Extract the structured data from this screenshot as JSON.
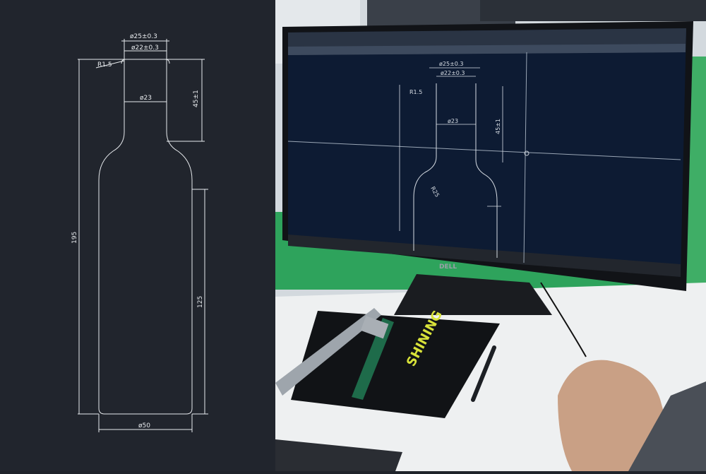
{
  "drawing": {
    "dim_outer_neck": "ø25±0.3",
    "dim_inner_neck": "ø22±0.3",
    "dim_radius": "R1.5",
    "dim_neck_width": "ø23",
    "dim_neck_height": "45±1",
    "dim_total_height": "195",
    "dim_body_height": "125",
    "dim_body_diameter": "ø50"
  },
  "photo": {
    "monitor_brand": "DELL",
    "notebook_brand": "SHINING",
    "screen_dims": {
      "outer": "ø25±0.3",
      "inner": "ø22±0.3",
      "radius": "R1.5",
      "neck": "ø23",
      "height": "45±1",
      "shoulder": "R25"
    }
  },
  "colors": {
    "drawing_bg": "#21252d",
    "line": "#e8ebee",
    "screen_bg": "#0d1b33",
    "desk": "#eef0f1",
    "green_wall": "#2ea35c"
  }
}
